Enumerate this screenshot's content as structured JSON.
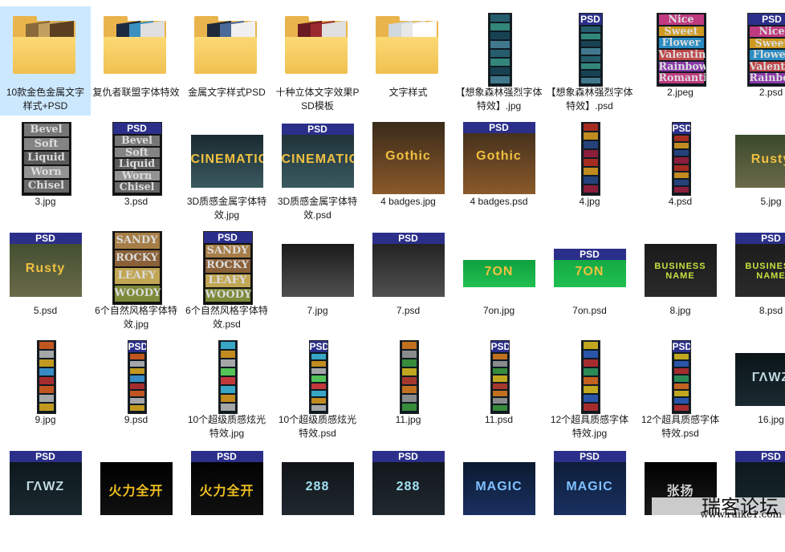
{
  "items": [
    {
      "label": "10款金色金属文字样式+PSD",
      "kind": "folder",
      "selected": true,
      "colors": [
        "#8a6a3a",
        "#c4a060",
        "#5a4020"
      ]
    },
    {
      "label": "复仇者联盟字体特效",
      "kind": "folder",
      "colors": [
        "#1a2a40",
        "#3a90c0",
        "#e0e0e0"
      ]
    },
    {
      "label": "金属文字样式PSD",
      "kind": "folder",
      "colors": [
        "#1e2a3a",
        "#4a6a9a",
        "#f0f0f0"
      ]
    },
    {
      "label": "十种立体文字效果PSD模板",
      "kind": "folder",
      "colors": [
        "#6a1a20",
        "#9a2a30",
        "#e0e0e0"
      ]
    },
    {
      "label": "文字样式",
      "kind": "folder",
      "colors": [
        "#cfd8dc",
        "#e8e8e8",
        "#ffffff"
      ]
    },
    {
      "label": "【想象森林强烈字体特效】.jpg",
      "kind": "tall",
      "psd": false,
      "colors": [
        "#2a6a7a",
        "#3a9a8a",
        "#1a4a5a",
        "#4a8aa0"
      ]
    },
    {
      "label": "【想象森林强烈字体特效】.psd",
      "kind": "tall",
      "psd": true,
      "colors": [
        "#2a6a7a",
        "#3a9a8a",
        "#1a4a5a",
        "#4a8aa0"
      ]
    },
    {
      "label": "2.jpeg",
      "kind": "tall",
      "psd": false,
      "wide": true,
      "colors": [
        "#e04090",
        "#f0b020",
        "#30a0e0",
        "#e05050",
        "#a040c0"
      ],
      "words": [
        "Nice",
        "Sweet",
        "Flower",
        "Valentine",
        "Rainbow",
        "Romantic"
      ]
    },
    {
      "label": "2.psd",
      "kind": "tall",
      "psd": true,
      "wide": true,
      "colors": [
        "#e04090",
        "#f0b020",
        "#30a0e0",
        "#e05050",
        "#a040c0"
      ],
      "words": [
        "Nice",
        "Sweet",
        "Flower",
        "Valentine",
        "Rainbow"
      ]
    },
    {
      "label": "3.jpg",
      "kind": "tall",
      "psd": false,
      "wide": true,
      "dark": true,
      "colors": [
        "#888",
        "#999",
        "#666",
        "#aaa",
        "#777"
      ],
      "words": [
        "Bevel",
        "Soft",
        "Liquid",
        "Worn",
        "Chisel"
      ]
    },
    {
      "label": "3.psd",
      "kind": "tall",
      "psd": true,
      "wide": true,
      "dark": true,
      "colors": [
        "#888",
        "#999",
        "#666",
        "#aaa",
        "#777"
      ],
      "words": [
        "Bevel",
        "Soft",
        "Liquid",
        "Worn",
        "Chisel"
      ]
    },
    {
      "label": "3D质感金属字体特效.jpg",
      "kind": "wide",
      "psd": false,
      "colors": [
        "#1a2a30",
        "#3a5a60"
      ],
      "text": "CINEMATIC"
    },
    {
      "label": "3D质感金属字体特效.psd",
      "kind": "wide",
      "psd": true,
      "colors": [
        "#1a2a30",
        "#3a5a60"
      ],
      "text": "CINEMATIC"
    },
    {
      "label": "4 badges.jpg",
      "kind": "wide",
      "psd": false,
      "tallish": true,
      "colors": [
        "#3a2a1a",
        "#8a5a2a"
      ],
      "text": "Gothic"
    },
    {
      "label": "4 badges.psd",
      "kind": "wide",
      "psd": true,
      "tallish": true,
      "colors": [
        "#3a2a1a",
        "#8a5a2a"
      ],
      "text": "Gothic"
    },
    {
      "label": "4.jpg",
      "kind": "tall",
      "psd": false,
      "narrow": true,
      "colors": [
        "#c03020",
        "#e0a020",
        "#2a4a8a",
        "#a02040"
      ]
    },
    {
      "label": "4.psd",
      "kind": "tall",
      "psd": true,
      "narrow": true,
      "colors": [
        "#c03020",
        "#e0a020",
        "#2a4a8a",
        "#a02040"
      ]
    },
    {
      "label": "5.jpg",
      "kind": "wide",
      "psd": false,
      "colors": [
        "#3a4a2a",
        "#6a6a4a"
      ],
      "text": "Rusty"
    },
    {
      "label": "5.psd",
      "kind": "wide",
      "psd": true,
      "colors": [
        "#3a4a2a",
        "#6a6a4a"
      ],
      "text": "Rusty"
    },
    {
      "label": "6个自然风格字体特效.jpg",
      "kind": "tall",
      "psd": false,
      "wide": true,
      "dark": true,
      "colors": [
        "#c09050",
        "#a07040",
        "#e0c060",
        "#90a040",
        "#8a6030"
      ],
      "words": [
        "SANDY",
        "ROCKY",
        "LEAFY",
        "WOODY"
      ]
    },
    {
      "label": "6个自然风格字体特效.psd",
      "kind": "tall",
      "psd": true,
      "wide": true,
      "dark": true,
      "colors": [
        "#c09050",
        "#a07040",
        "#e0c060",
        "#90a040",
        "#8a6030"
      ],
      "words": [
        "SANDY",
        "ROCKY",
        "LEAFY",
        "WOODY"
      ]
    },
    {
      "label": "7.jpg",
      "kind": "wide",
      "psd": false,
      "colors": [
        "#1a1a1a",
        "#505050"
      ],
      "text": ""
    },
    {
      "label": "7.psd",
      "kind": "wide",
      "psd": true,
      "colors": [
        "#1a1a1a",
        "#505050"
      ],
      "text": ""
    },
    {
      "label": "7on.jpg",
      "kind": "wide",
      "psd": false,
      "green": true,
      "colors": [
        "#10a040",
        "#20c050"
      ],
      "text": "7ON"
    },
    {
      "label": "7on.psd",
      "kind": "wide",
      "psd": true,
      "green": true,
      "colors": [
        "#10a040",
        "#20c050"
      ],
      "text": "7ON"
    },
    {
      "label": "8.jpg",
      "kind": "wide",
      "psd": false,
      "colors": [
        "#1a1a1a",
        "#2a2a2a"
      ],
      "text": "BUSINESS NAME",
      "textcolor": "#c8e040"
    },
    {
      "label": "8.psd",
      "kind": "wide",
      "psd": true,
      "colors": [
        "#1a1a1a",
        "#2a2a2a"
      ],
      "text": "BUSINESS NAME",
      "textcolor": "#c8e040"
    },
    {
      "label": "9.jpg",
      "kind": "tall",
      "psd": false,
      "narrow": true,
      "colors": [
        "#e06020",
        "#c0c0c0",
        "#e0b020",
        "#40a0e0",
        "#c03030"
      ]
    },
    {
      "label": "9.psd",
      "kind": "tall",
      "psd": true,
      "narrow": true,
      "colors": [
        "#e06020",
        "#c0c0c0",
        "#e0b020",
        "#40a0e0",
        "#c03030"
      ]
    },
    {
      "label": "10个超级质感炫光特效.jpg",
      "kind": "tall",
      "psd": false,
      "narrow": true,
      "colors": [
        "#40c0e0",
        "#e0a020",
        "#c0c0c0",
        "#60e060",
        "#e04040"
      ]
    },
    {
      "label": "10个超级质感炫光特效.psd",
      "kind": "tall",
      "psd": true,
      "narrow": true,
      "colors": [
        "#40c0e0",
        "#e0a020",
        "#c0c0c0",
        "#60e060",
        "#e04040"
      ]
    },
    {
      "label": "11.jpg",
      "kind": "tall",
      "psd": false,
      "narrow": true,
      "colors": [
        "#e08020",
        "#a0a0a0",
        "#40a040",
        "#e0c020",
        "#c04030"
      ]
    },
    {
      "label": "11.psd",
      "kind": "tall",
      "psd": true,
      "narrow": true,
      "colors": [
        "#e08020",
        "#a0a0a0",
        "#40a040",
        "#e0c020",
        "#c04030"
      ]
    },
    {
      "label": "12个超具质感字体特效.jpg",
      "kind": "tall",
      "psd": false,
      "narrow": true,
      "colors": [
        "#e0c020",
        "#3060c0",
        "#c03030",
        "#30a060",
        "#e07020"
      ]
    },
    {
      "label": "12个超具质感字体特效.psd",
      "kind": "tall",
      "psd": true,
      "narrow": true,
      "colors": [
        "#e0c020",
        "#3060c0",
        "#c03030",
        "#30a060",
        "#e07020"
      ]
    },
    {
      "label": "16.jpg",
      "kind": "wide",
      "psd": false,
      "colors": [
        "#0a1418",
        "#1a2a30"
      ],
      "text": "ΓΛWZ",
      "textcolor": "#c0d8e0"
    },
    {
      "label": "",
      "kind": "wide",
      "psd": true,
      "colors": [
        "#0a1418",
        "#1a2a30"
      ],
      "text": "ΓΛWZ",
      "textcolor": "#c0d8e0"
    },
    {
      "label": "",
      "kind": "wide",
      "psd": false,
      "colors": [
        "#000000",
        "#101010"
      ],
      "text": "火力全开",
      "textcolor": "#f0c020"
    },
    {
      "label": "",
      "kind": "wide",
      "psd": true,
      "colors": [
        "#000000",
        "#101010"
      ],
      "text": "火力全开",
      "textcolor": "#f0c020"
    },
    {
      "label": "",
      "kind": "wide",
      "psd": false,
      "colors": [
        "#101418",
        "#202830"
      ],
      "text": "288",
      "textcolor": "#a0e0f0"
    },
    {
      "label": "",
      "kind": "wide",
      "psd": true,
      "colors": [
        "#101418",
        "#202830"
      ],
      "text": "288",
      "textcolor": "#a0e0f0"
    },
    {
      "label": "",
      "kind": "wide",
      "psd": false,
      "colors": [
        "#0a1a30",
        "#1a3060"
      ],
      "text": "MAGIC",
      "textcolor": "#80c0ff"
    },
    {
      "label": "",
      "kind": "wide",
      "psd": true,
      "colors": [
        "#0a1a30",
        "#1a3060"
      ],
      "text": "MAGIC",
      "textcolor": "#80c0ff"
    },
    {
      "label": "",
      "kind": "wide",
      "psd": false,
      "colors": [
        "#000",
        "#1a1a1a"
      ],
      "text": "张扬",
      "textcolor": "#d0d0d0"
    },
    {
      "label": "",
      "kind": "wide",
      "psd": true,
      "colors": [
        "#0a1418",
        "#1a2a30"
      ],
      "text": "",
      "textcolor": "#c0d8e0"
    }
  ],
  "psd_badge": "PSD",
  "watermark": {
    "title": "瑞客论坛",
    "url": "www.ruike1.com"
  }
}
